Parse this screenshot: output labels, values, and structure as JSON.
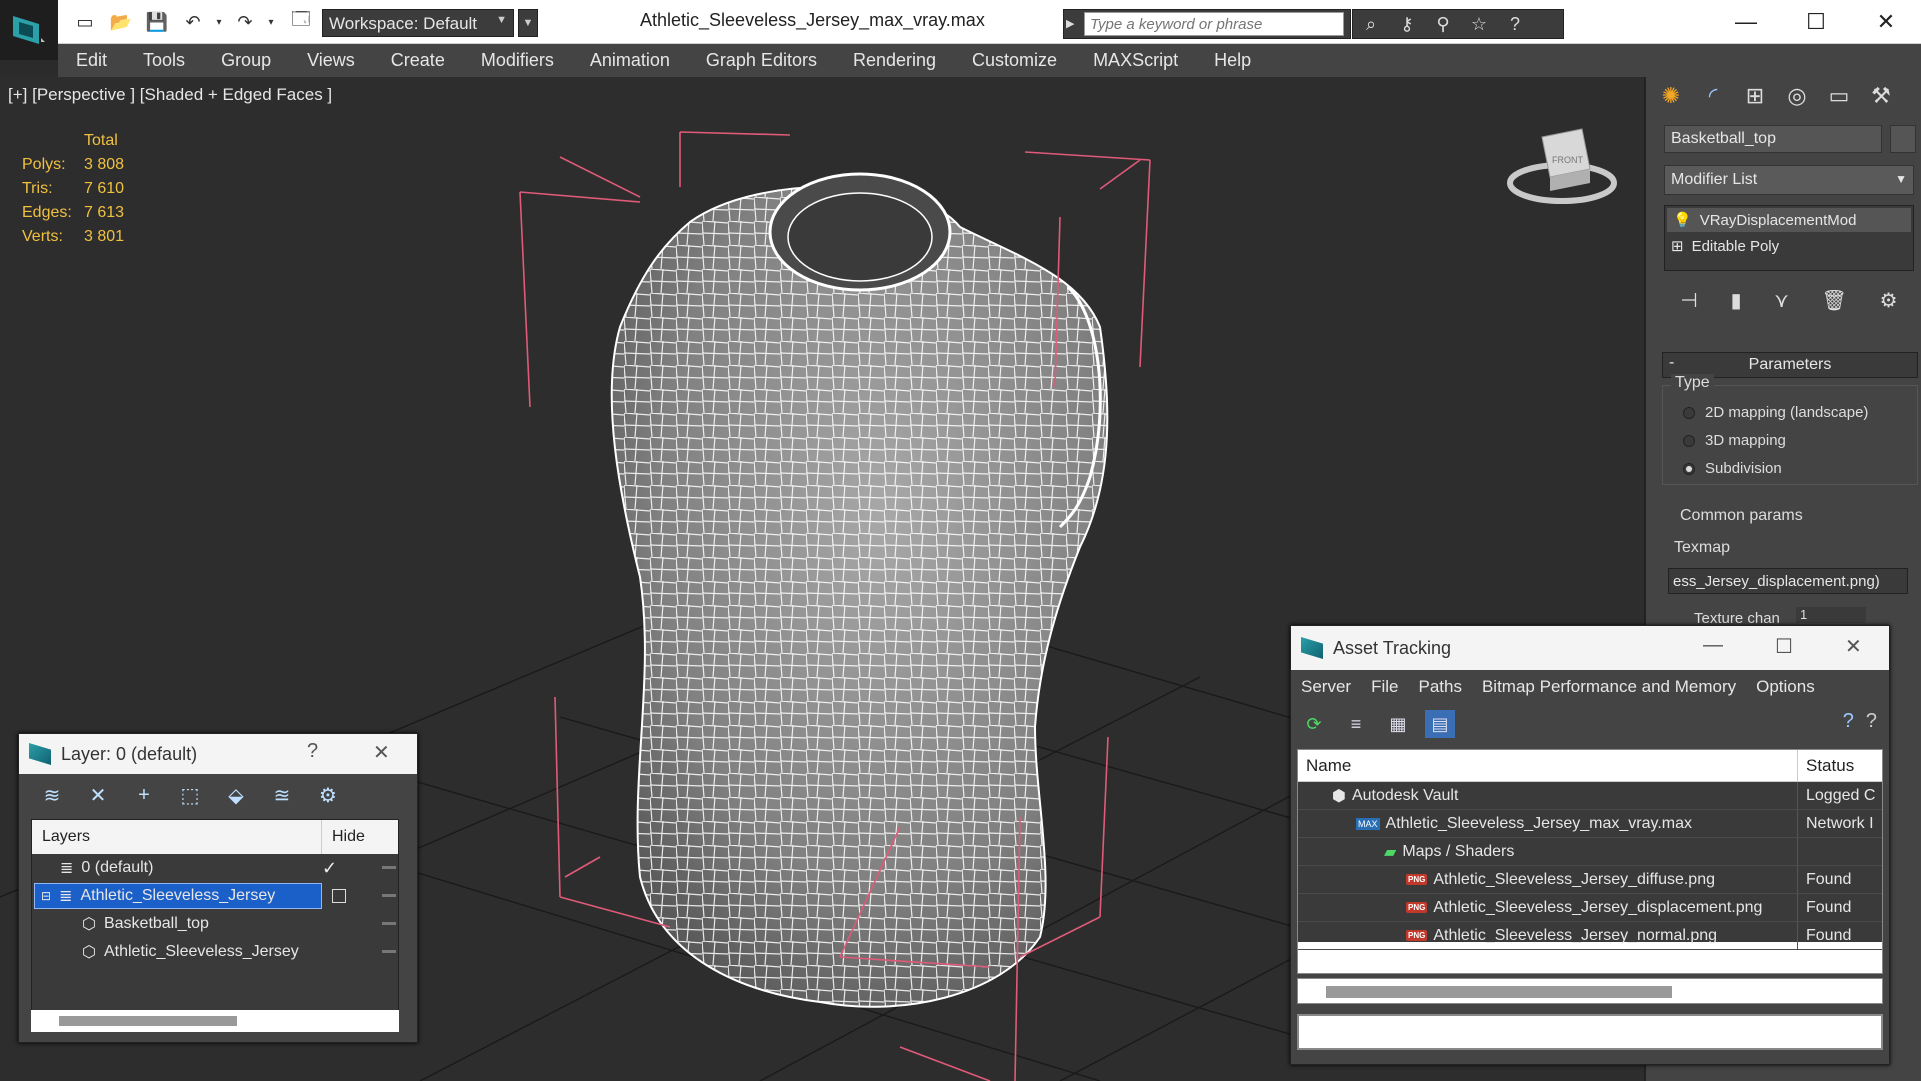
{
  "window": {
    "title": "Athletic_Sleeveless_Jersey_max_vray.max",
    "workspace": "Workspace: Default",
    "search_placeholder": "Type a keyword or phrase"
  },
  "menu": [
    "Edit",
    "Tools",
    "Group",
    "Views",
    "Create",
    "Modifiers",
    "Animation",
    "Graph Editors",
    "Rendering",
    "Customize",
    "MAXScript",
    "Help"
  ],
  "viewport": {
    "label": "[+] [Perspective ] [Shaded + Edged Faces ]",
    "stats": {
      "header": "Total",
      "rows": [
        {
          "k": "Polys:",
          "v": "3 808"
        },
        {
          "k": "Tris:",
          "v": "7 610"
        },
        {
          "k": "Edges:",
          "v": "7 613"
        },
        {
          "k": "Verts:",
          "v": "3 801"
        }
      ]
    },
    "viewcube_label": "FRONT"
  },
  "command_panel": {
    "object_name": "Basketball_top",
    "modifier_list": "Modifier List",
    "stack": [
      "VRayDisplacementMod",
      "Editable Poly"
    ],
    "rollout_title": "Parameters",
    "type_group": "Type",
    "type_options": [
      {
        "label": "2D mapping (landscape)",
        "selected": false
      },
      {
        "label": "3D mapping",
        "selected": false
      },
      {
        "label": "Subdivision",
        "selected": true
      }
    ],
    "common_params": "Common params",
    "texmap_label": "Texmap",
    "texmap_value": "ess_Jersey_displacement.png)",
    "texture_chan": "Texture chan",
    "texture_chan_value": "1"
  },
  "layer_dialog": {
    "title": "Layer: 0 (default)",
    "help": "?",
    "col_layers": "Layers",
    "col_hide": "Hide",
    "rows": [
      {
        "name": "0 (default)",
        "level": 0,
        "selected": false
      },
      {
        "name": "Athletic_Sleeveless_Jersey",
        "level": 0,
        "selected": true
      },
      {
        "name": "Basketball_top",
        "level": 1,
        "selected": false
      },
      {
        "name": "Athletic_Sleeveless_Jersey",
        "level": 1,
        "selected": false
      }
    ]
  },
  "asset_dialog": {
    "title": "Asset Tracking",
    "menu": [
      "Server",
      "File",
      "Paths",
      "Bitmap Performance and Memory",
      "Options"
    ],
    "col_name": "Name",
    "col_status": "Status",
    "rows": [
      {
        "name": "Autodesk Vault",
        "status": "Logged C",
        "indent": 1
      },
      {
        "name": "Athletic_Sleeveless_Jersey_max_vray.max",
        "status": "Network I",
        "indent": 2
      },
      {
        "name": "Maps / Shaders",
        "status": "",
        "indent": 3
      },
      {
        "name": "Athletic_Sleeveless_Jersey_diffuse.png",
        "status": "Found",
        "indent": 4
      },
      {
        "name": "Athletic_Sleeveless_Jersey_displacement.png",
        "status": "Found",
        "indent": 4
      },
      {
        "name": "Athletic_Sleeveless_Jersey_normal.png",
        "status": "Found",
        "indent": 4
      }
    ]
  }
}
